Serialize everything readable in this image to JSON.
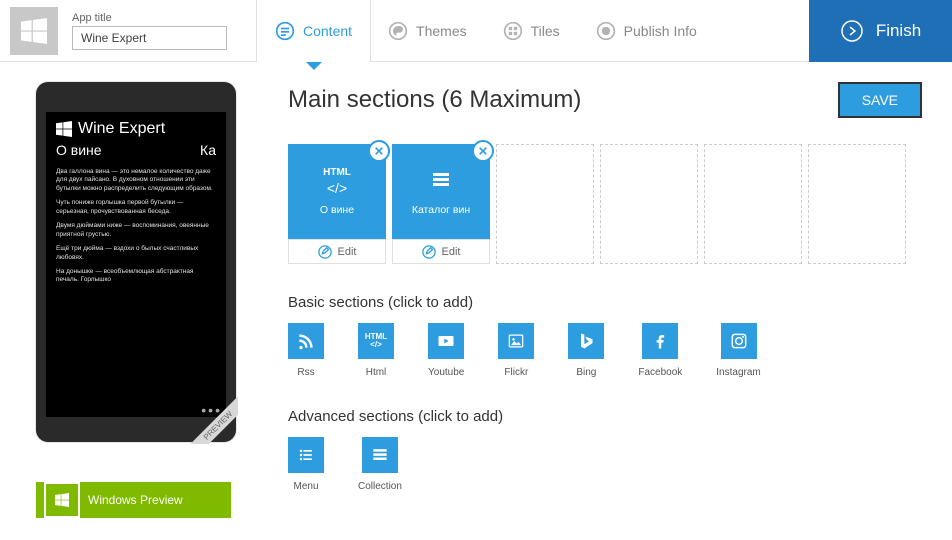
{
  "header": {
    "app_title_label": "App title",
    "app_title_value": "Wine Expert",
    "tabs": {
      "content": "Content",
      "themes": "Themes",
      "tiles": "Tiles",
      "publish": "Publish Info"
    },
    "finish": "Finish"
  },
  "preview": {
    "app_name": "Wine Expert",
    "sub_left": "О вине",
    "sub_right": "Ка",
    "paragraphs": [
      "Два галлона вина — это немалое количество даже для двух пайсано. В духовном отношении эти бутылки можно распределить следующим образом.",
      "Чуть пониже горлышка первой бутылки — серьезная, прочувствованная беседа.",
      "Двумя дюймами ниже — воспоминания, овеянные приятной грустью.",
      "Ещё три дюйма — вздохи о былых счастливых любовях.",
      "На донышке — всеобъемлющая абстрактная печаль. Горлышко"
    ],
    "ribbon": "PREVIEW",
    "wp_button": "Windows Preview"
  },
  "content": {
    "heading": "Main sections (6 Maximum)",
    "save": "SAVE",
    "tiles": [
      {
        "type": "html",
        "label": "HTML",
        "name": "О вине"
      },
      {
        "type": "collection",
        "label": "",
        "name": "Каталог вин"
      }
    ],
    "edit": "Edit",
    "basic_heading": "Basic sections (click to add)",
    "basic": [
      "Rss",
      "Html",
      "Youtube",
      "Flickr",
      "Bing",
      "Facebook",
      "Instagram"
    ],
    "advanced_heading": "Advanced sections (click to add)",
    "advanced": [
      "Menu",
      "Collection"
    ]
  }
}
